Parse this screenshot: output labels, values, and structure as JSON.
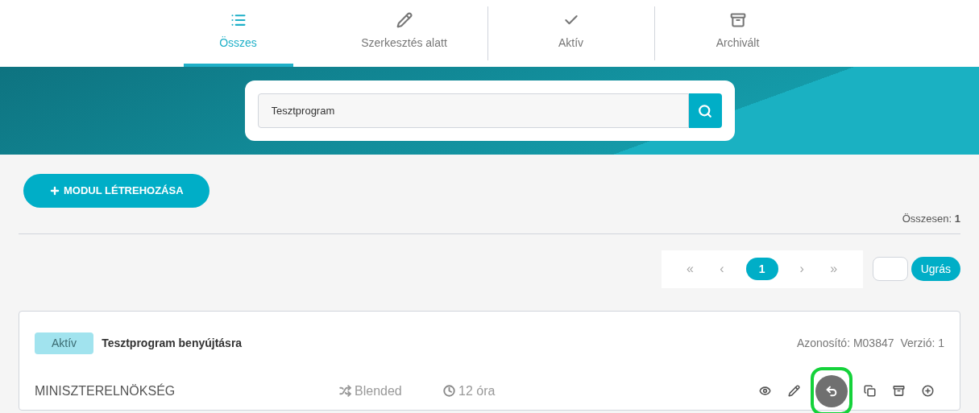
{
  "tabs": [
    {
      "label": "Összes",
      "selected": true
    },
    {
      "label": "Szerkesztés alatt",
      "selected": false
    },
    {
      "label": "Aktív",
      "selected": false
    },
    {
      "label": "Archivált",
      "selected": false
    }
  ],
  "search": {
    "value": "Tesztprogram"
  },
  "create_button": {
    "label": "MODUL LÉTREHOZÁSA"
  },
  "total": "Összesen: **1**",
  "pagination": {
    "pages": [
      {
        "label": "«",
        "kind": "nav",
        "selected": false
      },
      {
        "label": "‹",
        "kind": "nav",
        "selected": false
      },
      {
        "label": "1",
        "kind": "page",
        "selected": true
      },
      {
        "label": "›",
        "kind": "nav",
        "selected": false
      },
      {
        "label": "»",
        "kind": "nav",
        "selected": false
      }
    ],
    "jump_button": "Ugrás"
  },
  "modules": [
    {
      "status": "Aktív",
      "title": "Tesztprogram benyújtásra",
      "id": "Azonosító: M03847",
      "version": "Verzió: 1",
      "organization": "MINISZTERELNÖKSÉG",
      "format": "Blended",
      "duration": "12 óra",
      "actions": [
        {
          "kind": "view",
          "highlighted": false
        },
        {
          "kind": "edit",
          "highlighted": false
        },
        {
          "kind": "revert",
          "highlighted": true
        },
        {
          "kind": "copy",
          "highlighted": false
        },
        {
          "kind": "archive",
          "highlighted": false
        },
        {
          "kind": "add",
          "highlighted": false
        }
      ]
    }
  ]
}
